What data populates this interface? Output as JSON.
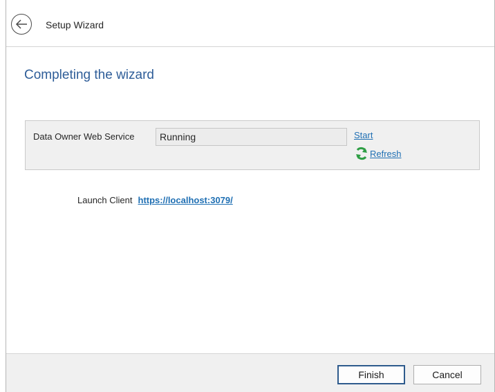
{
  "window": {
    "title": "Setup Wizard"
  },
  "page": {
    "heading": "Completing the wizard"
  },
  "service": {
    "label": "Data Owner Web Service",
    "status": "Running",
    "start_label": "Start",
    "refresh_label": "Refresh"
  },
  "launch": {
    "label": "Launch Client",
    "url": "https://localhost:3079/"
  },
  "footer": {
    "finish_label": "Finish",
    "cancel_label": "Cancel"
  },
  "colors": {
    "heading": "#2e5d98",
    "link": "#1f6fb3",
    "refresh_icon": "#2e9e44",
    "primary_button_border": "#2d5a8c"
  },
  "icons": {
    "back": "back-arrow-icon",
    "refresh": "refresh-icon"
  }
}
